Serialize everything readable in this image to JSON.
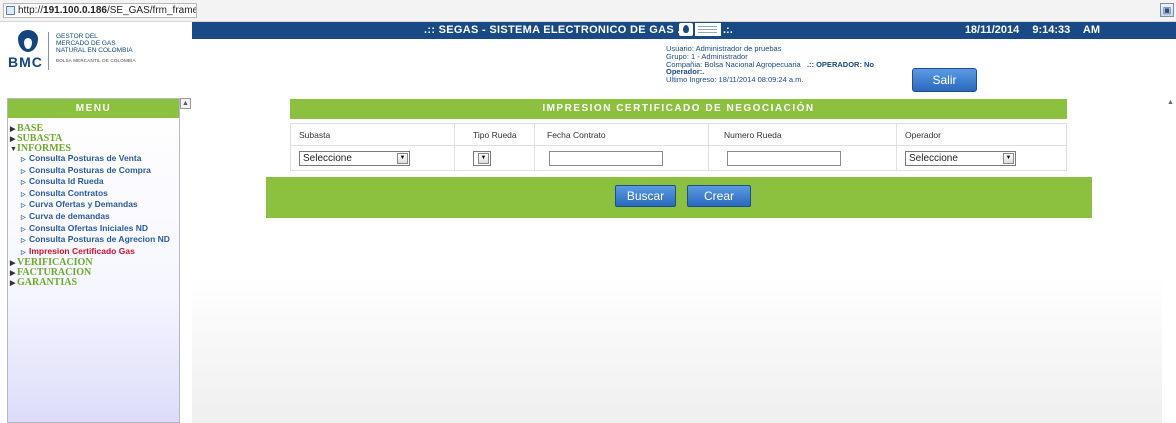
{
  "browser": {
    "url_prefix": "http://",
    "url_host": "191.100.0.186",
    "url_path": "/SE_GAS/frm_frame.aspx",
    "corner_icon": "window-icon"
  },
  "header": {
    "title": ".:: SEGAS - SISTEMA ELECTRONICO DE GAS .:.",
    "title_suffix": ".:.",
    "date": "18/11/2014",
    "time": "9:14:33 AM",
    "logo": {
      "brand": "BMC",
      "line1": "GESTOR DEL",
      "line2": "MERCADO DE GAS",
      "line3": "NATURAL EN COLOMBIA",
      "small": "BOLSA MERCANTIL DE COLOMBIA"
    },
    "user": {
      "usuario": "Usuario: Administrador de pruebas",
      "grupo": "Grupo: 1 - Administrador",
      "compania": "Compañia: Bolsa Nacional Agropecuaria",
      "operador_flag": ".:: OPERADOR: No",
      "operador": "Operador:.",
      "ultimo_ingreso": "Ultimo Ingreso: 18/11/2014 08:09:24 a.m."
    },
    "salir_label": "Salir"
  },
  "sidebar": {
    "title": "MENU",
    "items": [
      {
        "label": "BASE",
        "level": 0
      },
      {
        "label": "SUBASTA",
        "level": 0
      },
      {
        "label": "INFORMES",
        "level": 0,
        "expanded": true
      },
      {
        "label": "Consulta Posturas de Venta",
        "level": 1
      },
      {
        "label": "Consulta Posturas de Compra",
        "level": 1
      },
      {
        "label": "Consulta Id Rueda",
        "level": 1
      },
      {
        "label": "Consulta Contratos",
        "level": 1
      },
      {
        "label": "Curva Ofertas y Demandas",
        "level": 1
      },
      {
        "label": "Curva de demandas",
        "level": 1
      },
      {
        "label": "Consulta Ofertas Iniciales ND",
        "level": 1
      },
      {
        "label": "Consulta Posturas de Agrecion ND",
        "level": 1
      },
      {
        "label": "Impresion Certificado Gas",
        "level": 1,
        "active": true
      },
      {
        "label": "VERIFICACION",
        "level": 0
      },
      {
        "label": "FACTURACION",
        "level": 0
      },
      {
        "label": "GARANTIAS",
        "level": 0
      }
    ]
  },
  "form": {
    "title": "IMPRESION CERTIFICADO DE NEGOCIACIÓN",
    "columns": {
      "subasta": "Subasta",
      "tipo_rueda": "Tipo Rueda",
      "fecha_contrato": "Fecha Contrato",
      "numero_rueda": "Numero Rueda",
      "operador": "Operador"
    },
    "values": {
      "subasta": "Seleccione",
      "tipo_rueda": "",
      "fecha_contrato": "",
      "numero_rueda": "",
      "operador": "Seleccione"
    },
    "buscar_label": "Buscar",
    "crear_label": "Crear"
  },
  "colors": {
    "title_bar": "#1a4a86",
    "green": "#8cc13f",
    "button_blue": "#3a7bd0",
    "active_menu": "#d0102c"
  }
}
